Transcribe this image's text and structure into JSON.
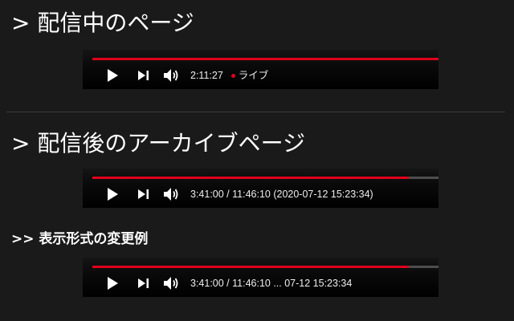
{
  "sections": {
    "live": {
      "heading": "> 配信中のページ",
      "player": {
        "progress_fraction": 1.0,
        "time_text": "2:11:27",
        "live_label": "ライブ"
      }
    },
    "archive": {
      "heading": "> 配信後のアーカイブページ",
      "player": {
        "progress_fraction": 0.915,
        "time_text": "3:41:00 / 11:46:10 (2020-07-12 15:23:34)"
      }
    },
    "format_example": {
      "heading": ">> 表示形式の変更例",
      "player": {
        "progress_fraction": 0.915,
        "time_text": "3:41:00 / 11:46:10 ... 07-12 15:23:34"
      }
    }
  },
  "controls": {
    "play_icon": "play-icon",
    "next_icon": "next-icon",
    "volume_icon": "volume-icon"
  },
  "colors": {
    "background": "#1a1a1a",
    "progress": "#e0001b",
    "live_dot": "#e0001b",
    "text": "#ffffff"
  }
}
